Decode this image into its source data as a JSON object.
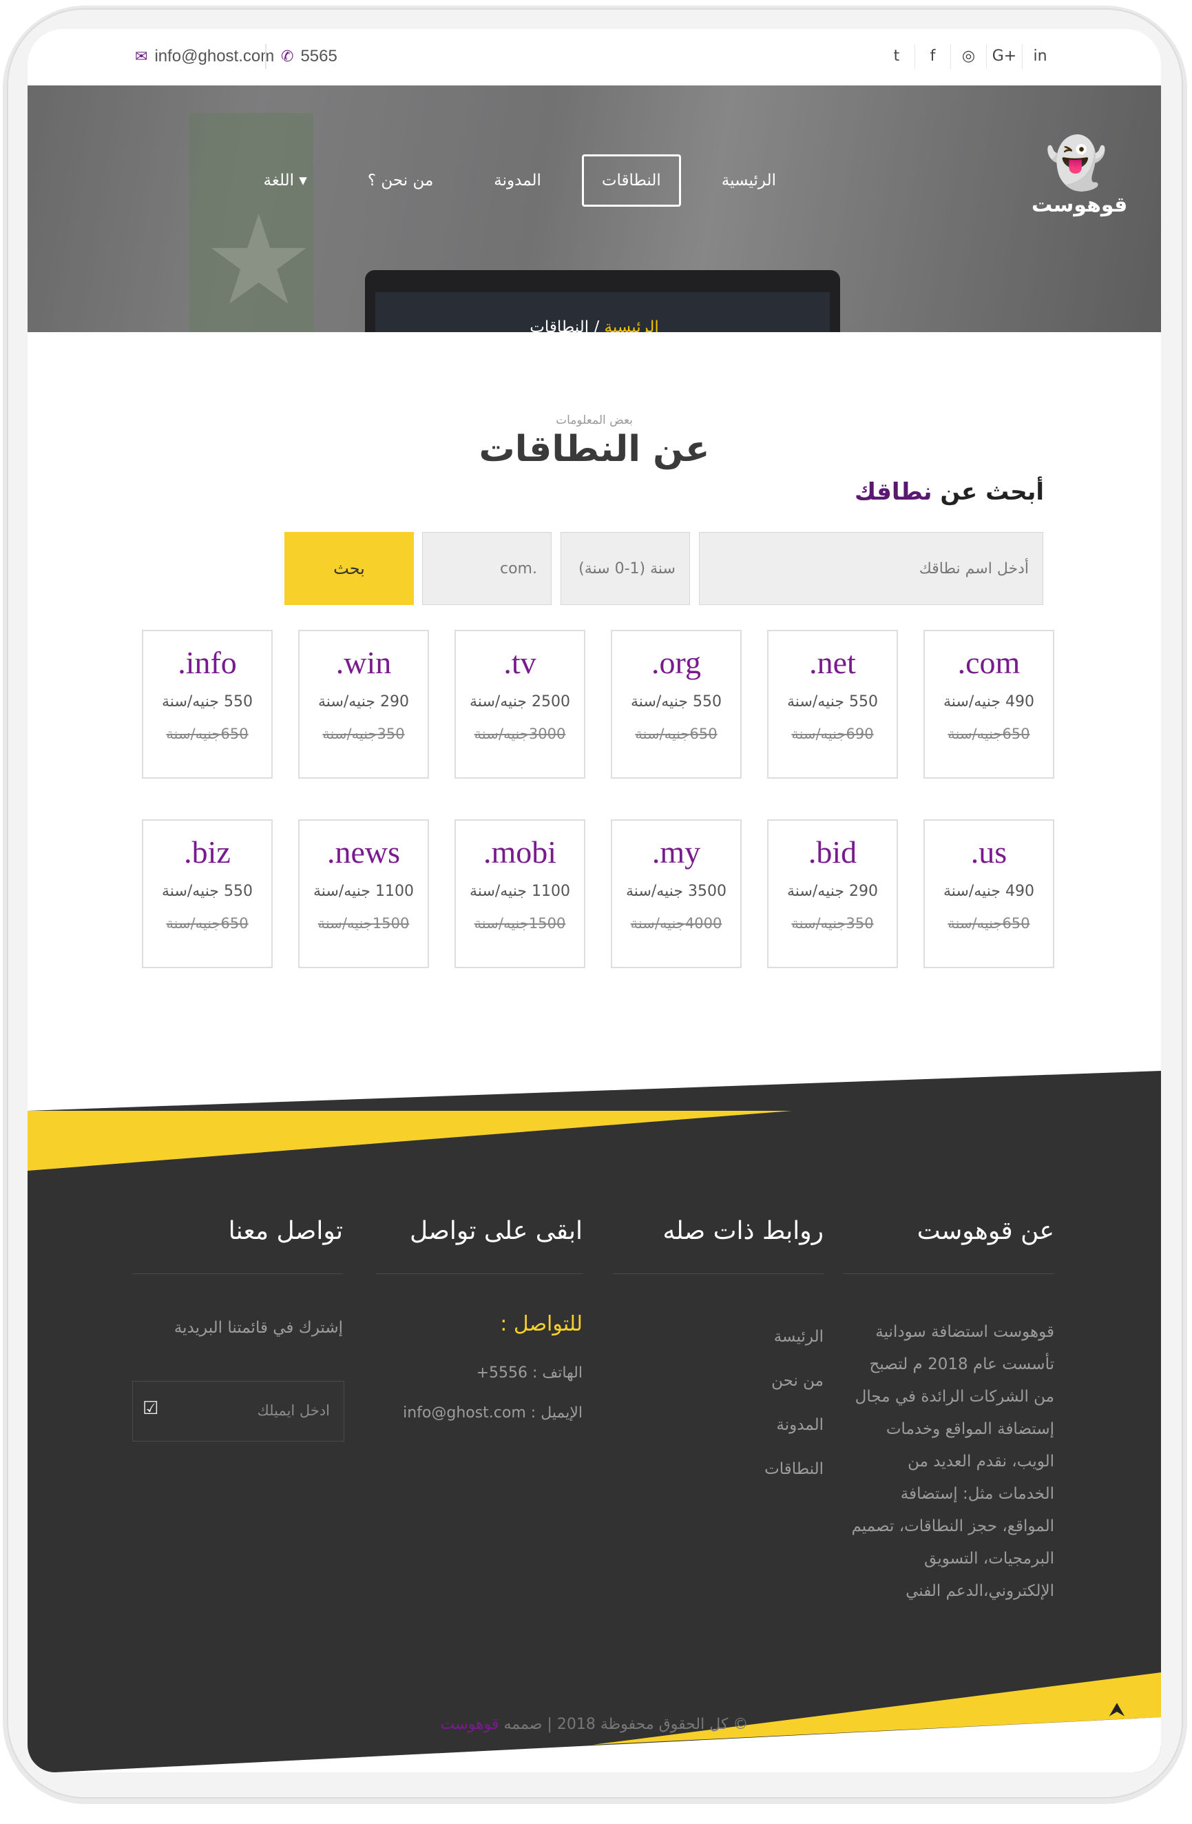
{
  "topbar": {
    "email": "info@ghost.com",
    "phone": "5565",
    "social": [
      "twitter-icon",
      "facebook-icon",
      "instagram-icon",
      "google-plus-icon",
      "linkedin-icon"
    ]
  },
  "brand": {
    "name": "قوهوست"
  },
  "nav": {
    "items": [
      {
        "label": "الرئيسية",
        "active": false
      },
      {
        "label": "النطاقات",
        "active": true
      },
      {
        "label": "المدونة",
        "active": false
      },
      {
        "label": "من نحن ؟",
        "active": false
      },
      {
        "label": "اللغة ▾",
        "active": false
      }
    ]
  },
  "breadcrumb": {
    "home": "الرئيسية",
    "sep": "/",
    "current": "النطاقات"
  },
  "section": {
    "subtitle": "بعض المعلومات",
    "title": "عن النطاقات",
    "search_title_a": "أبحث عن",
    "search_title_b": "نطاقك"
  },
  "search": {
    "name_placeholder": "أدخل اسم نطاقك",
    "years": "سنة (1-0 سنة)",
    "tld": ".com",
    "button": "بحث"
  },
  "domains": [
    {
      "ext": ".com",
      "price": "490 جنيه/سنة",
      "old": "650جنيه/سنة"
    },
    {
      "ext": ".net",
      "price": "550 جنيه/سنة",
      "old": "690جنيه/سنة"
    },
    {
      "ext": ".org",
      "price": "550 جنيه/سنة",
      "old": "650جنيه/سنة"
    },
    {
      "ext": ".tv",
      "price": "2500 جنيه/سنة",
      "old": "3000جنيه/سنة"
    },
    {
      "ext": ".win",
      "price": "290 جنيه/سنة",
      "old": "350جنيه/سنة"
    },
    {
      "ext": ".info",
      "price": "550 جنيه/سنة",
      "old": "650جنيه/سنة"
    },
    {
      "ext": ".us",
      "price": "490 جنيه/سنة",
      "old": "650جنيه/سنة"
    },
    {
      "ext": ".bid",
      "price": "290 جنيه/سنة",
      "old": "350جنيه/سنة"
    },
    {
      "ext": ".my",
      "price": "3500 جنيه/سنة",
      "old": "4000جنيه/سنة"
    },
    {
      "ext": ".mobi",
      "price": "1100 جنيه/سنة",
      "old": "1500جنيه/سنة"
    },
    {
      "ext": ".news",
      "price": "1100 جنيه/سنة",
      "old": "1500جنيه/سنة"
    },
    {
      "ext": ".biz",
      "price": "550 جنيه/سنة",
      "old": "650جنيه/سنة"
    }
  ],
  "footer": {
    "about_title": "عن قوهوست",
    "about_text": "قوهوست استضافة سودانية تأسست عام 2018 م لتصبح من الشركات الرائدة في مجال إستضافة المواقع وخدمات الويب، نقدم العديد من الخدمات مثل: إستضافة المواقع، حجز النطاقات، تصميم البرمجيات، التسويق الإلكتروني،الدعم الفني",
    "links_title": "روابط ذات صله",
    "links": [
      "الرئيسة",
      "من نحن",
      "المدونة",
      "النطاقات"
    ],
    "stay_title": "ابقى على تواصل",
    "contact_heading": "للتواصل :",
    "contact_phone": "الهاتف : 5556+",
    "contact_email": "الإيميل : info@ghost.com",
    "connect_title": "تواصل معنا",
    "subscribe_text": "إشترك في قائمتنا البريدية",
    "email_placeholder": "ادخل ايميلك",
    "copyright_text": "© كل الحقوق محفوظة 2018 | صممه",
    "copyright_brand": "قوهوست"
  },
  "colors": {
    "accent": "#f7d12a",
    "brand": "#7a1a8f",
    "footer": "#323232"
  }
}
